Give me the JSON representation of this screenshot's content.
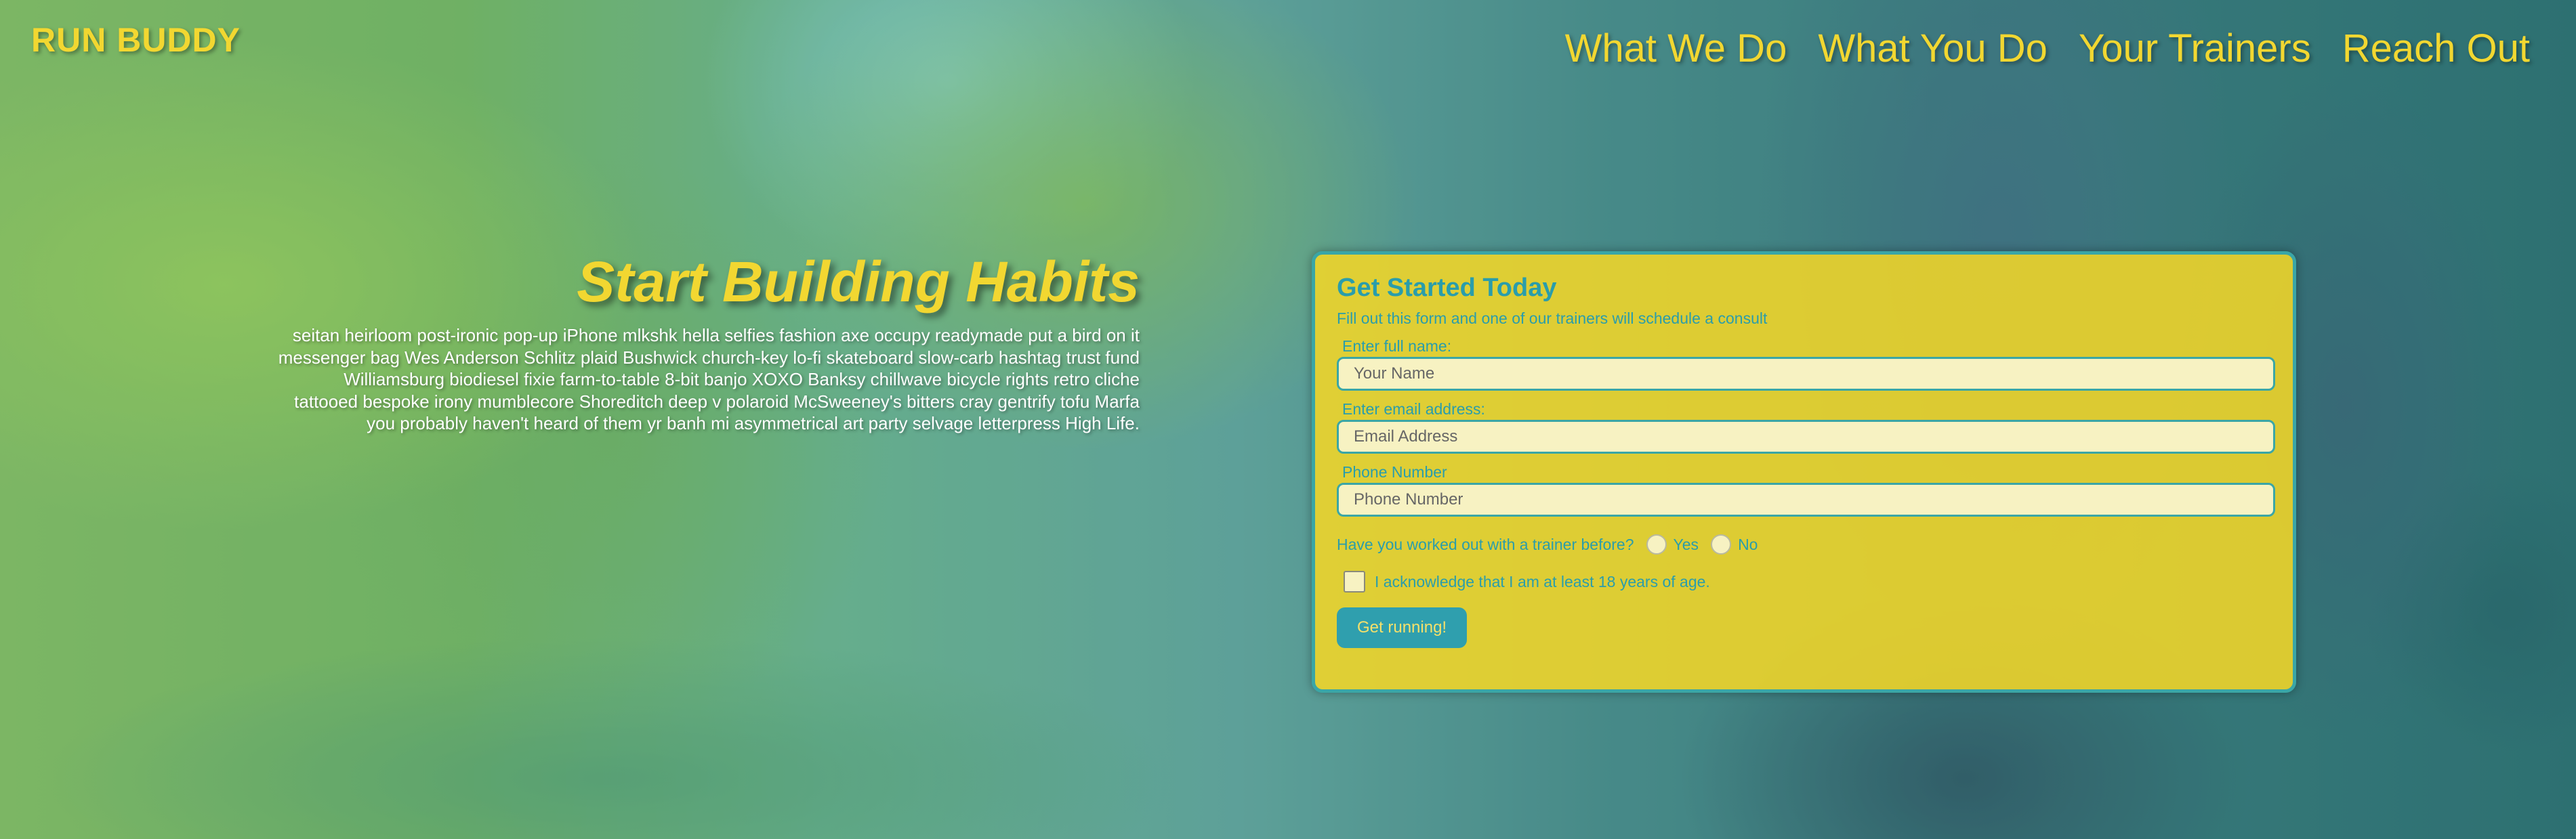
{
  "header": {
    "brand": "RUN BUDDY",
    "nav": [
      "What We Do",
      "What You Do",
      "Your Trainers",
      "Reach Out"
    ]
  },
  "hero": {
    "title": "Start Building Habits",
    "body": "seitan heirloom post-ironic pop-up iPhone mlkshk hella selfies fashion axe occupy readymade put a bird on it messenger bag Wes Anderson Schlitz plaid Bushwick church-key lo-fi skateboard slow-carb hashtag trust fund Williamsburg biodiesel fixie farm-to-table 8-bit banjo XOXO Banksy chillwave bicycle rights retro cliche tattooed bespoke irony mumblecore Shoreditch deep v polaroid McSweeney's bitters cray gentrify tofu Marfa you probably haven't heard of them yr banh mi asymmetrical art party selvage letterpress High Life."
  },
  "form": {
    "title": "Get Started Today",
    "subtitle": "Fill out this form and one of our trainers will schedule a consult",
    "fields": [
      {
        "label": "Enter full name:",
        "placeholder": "Your Name"
      },
      {
        "label": "Enter email address:",
        "placeholder": "Email Address"
      },
      {
        "label": "Phone Number",
        "placeholder": "Phone Number"
      }
    ],
    "trainer_question": "Have you worked out with a trainer before?",
    "options": [
      "Yes",
      "No"
    ],
    "acknowledge": "I acknowledge that I am at least 18 years of age.",
    "submit": "Get running!"
  },
  "colors": {
    "accent_yellow": "#f2d731",
    "teal": "#2a9dab"
  }
}
